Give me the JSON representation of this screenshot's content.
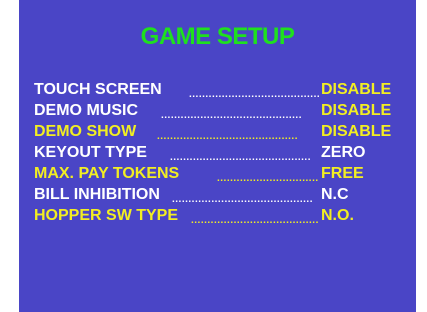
{
  "screen_title": "GAME SETUP",
  "colors": {
    "background": "#4a45c6",
    "title": "#1fe01f",
    "normal_item": "#ffffff",
    "highlight_item": "#f2ee22"
  },
  "menu": {
    "items": [
      {
        "label": "TOUCH SCREEN",
        "dots": "...........................................",
        "value": "DISABLE",
        "style": "white-label-yellow-value"
      },
      {
        "label": "DEMO MUSIC",
        "dots": "...........................................",
        "value": "DISABLE",
        "style": "white-label-yellow-value"
      },
      {
        "label": "DEMO SHOW",
        "dots": "...........................................",
        "value": "DISABLE",
        "style": "yellow"
      },
      {
        "label": "KEYOUT TYPE",
        "dots": "...........................................",
        "value": "ZERO",
        "style": "white"
      },
      {
        "label": "MAX. PAY TOKENS",
        "dots": "...........................................",
        "value": "FREE",
        "style": "yellow"
      },
      {
        "label": "BILL INHIBITION",
        "dots": "...........................................",
        "value": "N.C",
        "style": "white"
      },
      {
        "label": "HOPPER SW TYPE",
        "dots": "...........................................",
        "value": "N.O.",
        "style": "yellow"
      }
    ]
  }
}
